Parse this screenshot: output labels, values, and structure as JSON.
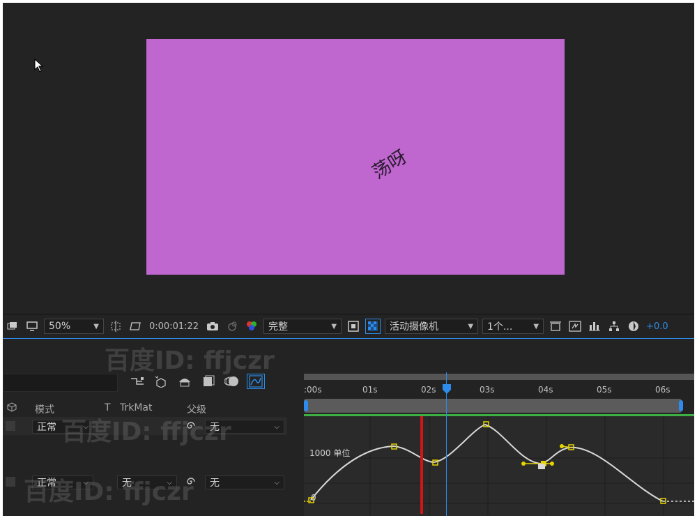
{
  "viewer": {
    "canvas_text": "荡呀",
    "canvas_color": "#bf67cf"
  },
  "toolbar": {
    "zoom": "50%",
    "timecode": "0:00:01:22",
    "resolution": "完整",
    "camera": "活动摄像机",
    "views": "1个...",
    "exposure": "+0.0"
  },
  "timeline": {
    "headers": {
      "mode": "模式",
      "t": "T",
      "trkmat": "TrkMat",
      "parent": "父级"
    },
    "layers": [
      {
        "mode": "正常",
        "parent": "无"
      },
      {
        "mode": "正常",
        "trkmat": "无",
        "parent": "无"
      }
    ],
    "ruler_labels": [
      ":00s",
      "01s",
      "02s",
      "03s",
      "04s",
      "05s",
      "06s"
    ],
    "graph_label": "1000 单位",
    "graph_zero": "0"
  },
  "watermark": {
    "text": "百度ID: ffjczr"
  },
  "colors": {
    "accent": "#2d8ceb",
    "background": "#232323",
    "green_bar": "#3cb043",
    "marker_red": "#d21515",
    "keyframe_yellow": "#e6d400"
  }
}
